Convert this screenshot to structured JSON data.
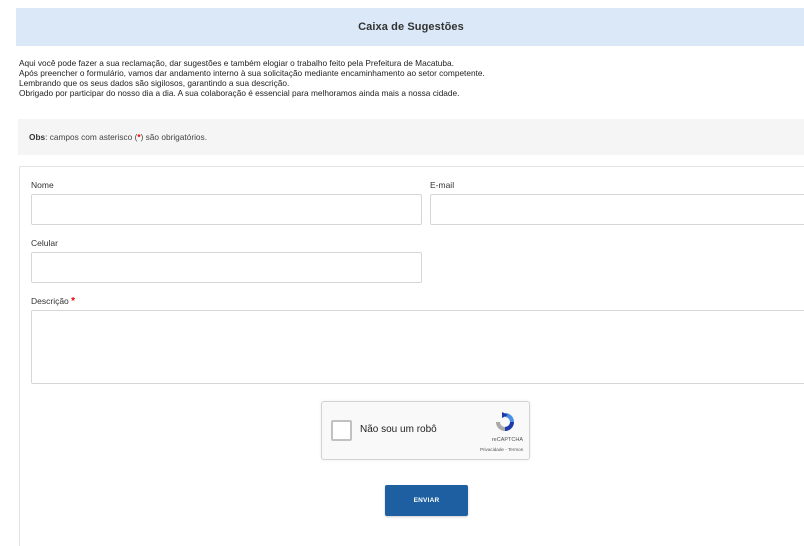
{
  "header": {
    "title": "Caixa de Sugestões"
  },
  "intro": {
    "lines": [
      "Aqui você pode fazer a sua reclamação, dar sugestões e também elogiar o trabalho feito pela Prefeitura de Macatuba.",
      "Após preencher o formulário, vamos dar andamento interno à sua solicitação mediante encaminhamento ao setor competente.",
      "Lembrando que os seus dados são sigilosos, garantindo a sua descrição.",
      "Obrigado por participar do nosso dia a dia. A sua colaboração é essencial para melhoramos ainda mais a nossa cidade."
    ]
  },
  "obs": {
    "label": "Obs",
    "text_before": ": campos com asterisco (",
    "asterisk": "*",
    "text_after": ") são obrigatórios."
  },
  "form": {
    "nome_label": "Nome",
    "nome_value": "",
    "email_label": "E-mail",
    "email_value": "",
    "celular_label": "Celular",
    "celular_value": "",
    "descricao_label": "Descrição",
    "descricao_required": "*",
    "descricao_value": ""
  },
  "recaptcha": {
    "label": "Não sou um robô",
    "brand": "reCAPTCHA",
    "links": "Privacidade - Termos",
    "checked": false
  },
  "submit": {
    "label": "ENVIAR"
  },
  "colors": {
    "header_bg": "#dbe8f7",
    "obs_bg": "#f5f5f5",
    "button_bg": "#1d5fa0",
    "required": "#e00000"
  }
}
